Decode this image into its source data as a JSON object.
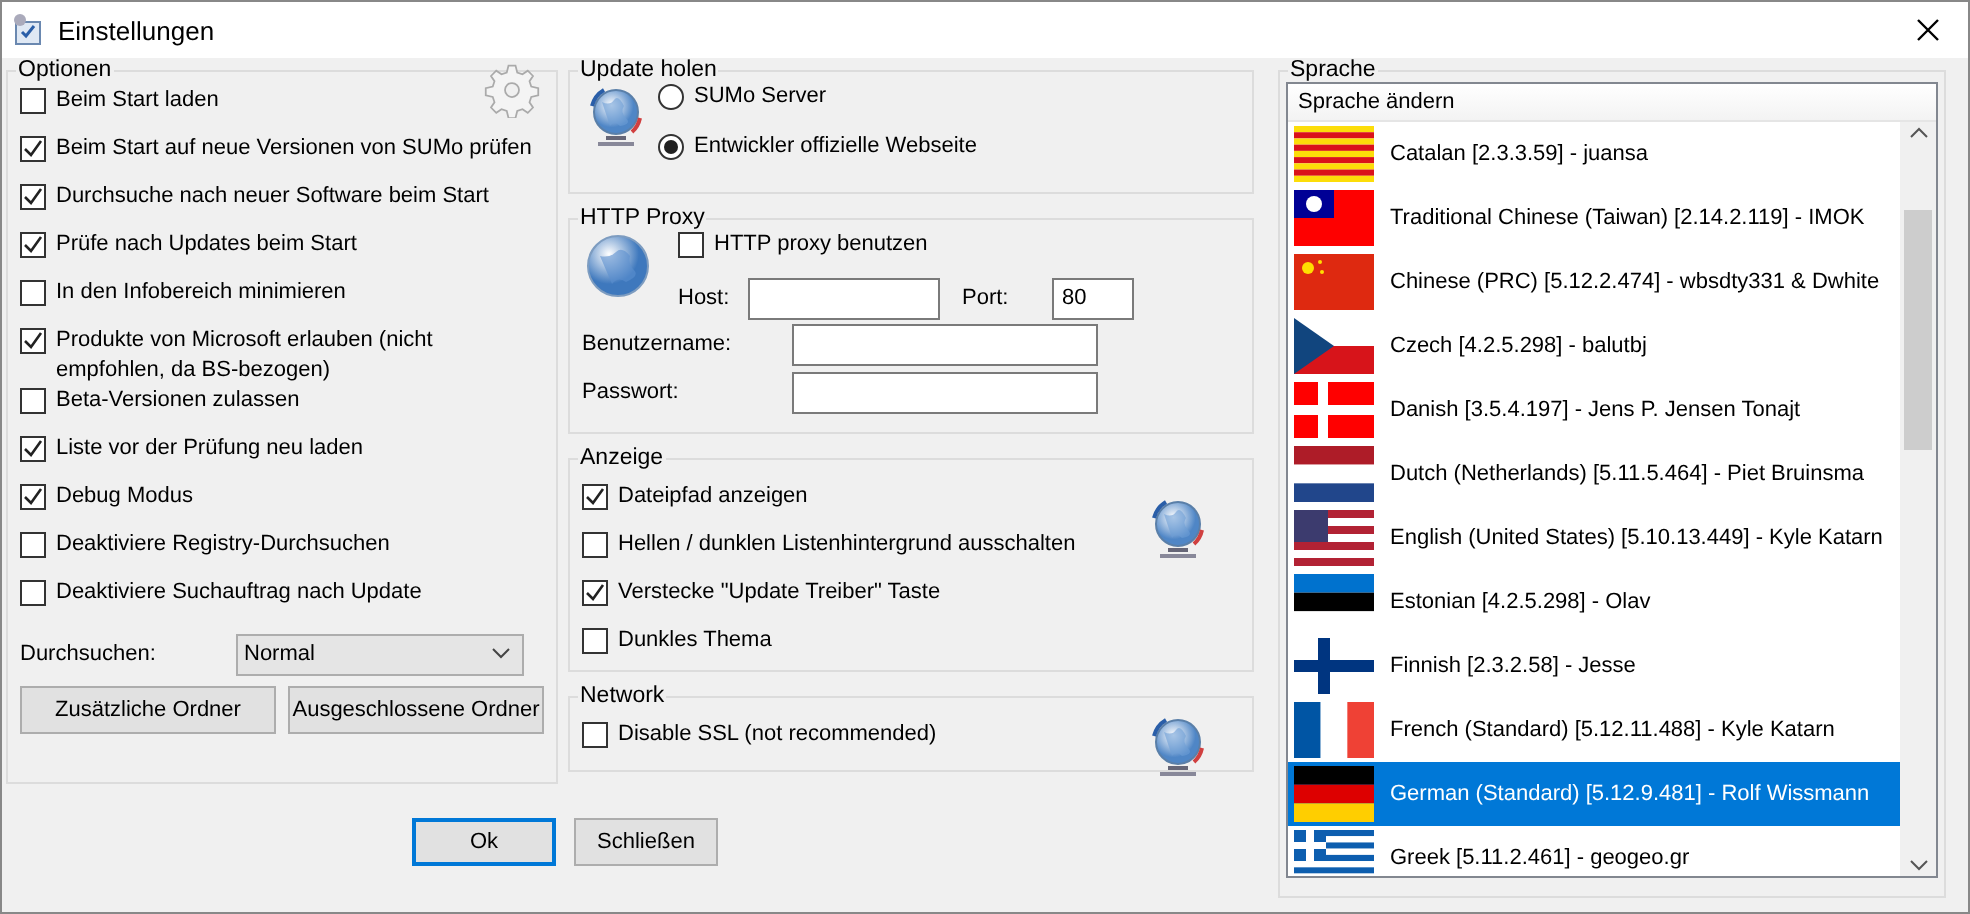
{
  "window": {
    "title": "Einstellungen"
  },
  "options": {
    "title": "Optionen",
    "checkboxes": [
      {
        "label": "Beim Start laden",
        "checked": false
      },
      {
        "label": "Beim Start auf neue Versionen von SUMo prüfen",
        "checked": true
      },
      {
        "label": "Durchsuche nach neuer Software beim Start",
        "checked": true
      },
      {
        "label": "Prüfe nach Updates beim Start",
        "checked": true
      },
      {
        "label": "In den Infobereich minimieren",
        "checked": false
      },
      {
        "label": "Produkte von Microsoft erlauben (nicht empfohlen, da BS-bezogen)",
        "checked": true
      },
      {
        "label": "Beta-Versionen zulassen",
        "checked": false
      },
      {
        "label": "Liste vor der Prüfung neu laden",
        "checked": true
      },
      {
        "label": "Debug Modus",
        "checked": true
      },
      {
        "label": "Deaktiviere Registry-Durchsuchen",
        "checked": false
      },
      {
        "label": "Deaktiviere Suchauftrag nach Update",
        "checked": false
      }
    ],
    "scan": {
      "label": "Durchsuchen:",
      "value": "Normal"
    },
    "buttons": [
      "Zusätzliche Ordner",
      "Ausgeschlossene Ordner"
    ]
  },
  "update": {
    "title": "Update holen",
    "radios": [
      {
        "label": "SUMo Server",
        "selected": false
      },
      {
        "label": "Entwickler offizielle Webseite",
        "selected": true
      }
    ]
  },
  "proxy": {
    "title": "HTTP Proxy",
    "use": {
      "label": "HTTP proxy benutzen",
      "checked": false
    },
    "host": {
      "label": "Host:"
    },
    "port": {
      "label": "Port:",
      "value": "80"
    },
    "username": {
      "label": "Benutzername:"
    },
    "password": {
      "label": "Passwort:"
    }
  },
  "display": {
    "title": "Anzeige",
    "checkboxes": [
      {
        "label": "Dateipfad anzeigen",
        "checked": true
      },
      {
        "label": "Hellen / dunklen Listenhintergrund ausschalten",
        "checked": false
      },
      {
        "label": "Verstecke \"Update Treiber\" Taste",
        "checked": true
      },
      {
        "label": "Dunkles Thema",
        "checked": false
      }
    ]
  },
  "network": {
    "title": "Network",
    "checkboxes": [
      {
        "label": "Disable SSL (not recommended)",
        "checked": false
      }
    ]
  },
  "language": {
    "title": "Sprache",
    "header": "Sprache ändern",
    "items": [
      {
        "label": "Catalan [2.3.3.59] - juansa",
        "kind": "ct",
        "selected": false
      },
      {
        "label": "Traditional Chinese (Taiwan) [2.14.2.119] - IMOK",
        "kind": "tw",
        "selected": false
      },
      {
        "label": "Chinese (PRC) [5.12.2.474] - wbsdty331 & Dwhite",
        "kind": "cn",
        "selected": false
      },
      {
        "label": "Czech [4.2.5.298] - balutbj",
        "kind": "cz",
        "selected": false
      },
      {
        "label": "Danish [3.5.4.197] - Jens P. Jensen Tonajt",
        "kind": "dk",
        "selected": false
      },
      {
        "label": "Dutch (Netherlands) [5.11.5.464] - Piet Bruinsma",
        "kind": "nl",
        "selected": false
      },
      {
        "label": "English (United States) [5.10.13.449] - Kyle Katarn",
        "kind": "us",
        "selected": false
      },
      {
        "label": "Estonian [4.2.5.298] - Olav",
        "kind": "ee",
        "selected": false
      },
      {
        "label": "Finnish [2.3.2.58] - Jesse",
        "kind": "fi",
        "selected": false
      },
      {
        "label": "French (Standard) [5.12.11.488] - Kyle Katarn",
        "kind": "fr",
        "selected": false
      },
      {
        "label": "German (Standard) [5.12.9.481] - Rolf Wissmann",
        "kind": "de",
        "selected": true
      },
      {
        "label": "Greek [5.11.2.461] - geogeo.gr",
        "kind": "gr",
        "selected": false
      }
    ]
  },
  "buttons": [
    {
      "label": "Ok",
      "default": true
    },
    {
      "label": "Schließen",
      "default": false
    }
  ]
}
